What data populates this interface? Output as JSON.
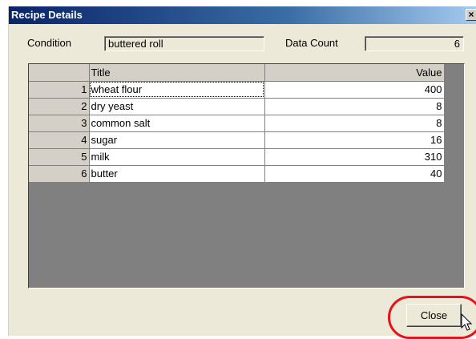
{
  "window": {
    "title": "Recipe Details",
    "close_glyph": "×"
  },
  "condition": {
    "label": "Condition",
    "value": "buttered roll"
  },
  "data_count": {
    "label": "Data Count",
    "value": "6"
  },
  "table": {
    "columns": [
      "Title",
      "Value"
    ],
    "rows": [
      {
        "num": "1",
        "title": "wheat flour",
        "value": "400"
      },
      {
        "num": "2",
        "title": "dry yeast",
        "value": "8"
      },
      {
        "num": "3",
        "title": "common salt",
        "value": "8"
      },
      {
        "num": "4",
        "title": "sugar",
        "value": "16"
      },
      {
        "num": "5",
        "title": "milk",
        "value": "310"
      },
      {
        "num": "6",
        "title": "butter",
        "value": "40"
      }
    ]
  },
  "buttons": {
    "close_label": "Close"
  },
  "colors": {
    "highlight": "#e8101a",
    "titlebar": "#0a246a"
  },
  "icons": {
    "cursor": "mouse-pointer-icon"
  }
}
